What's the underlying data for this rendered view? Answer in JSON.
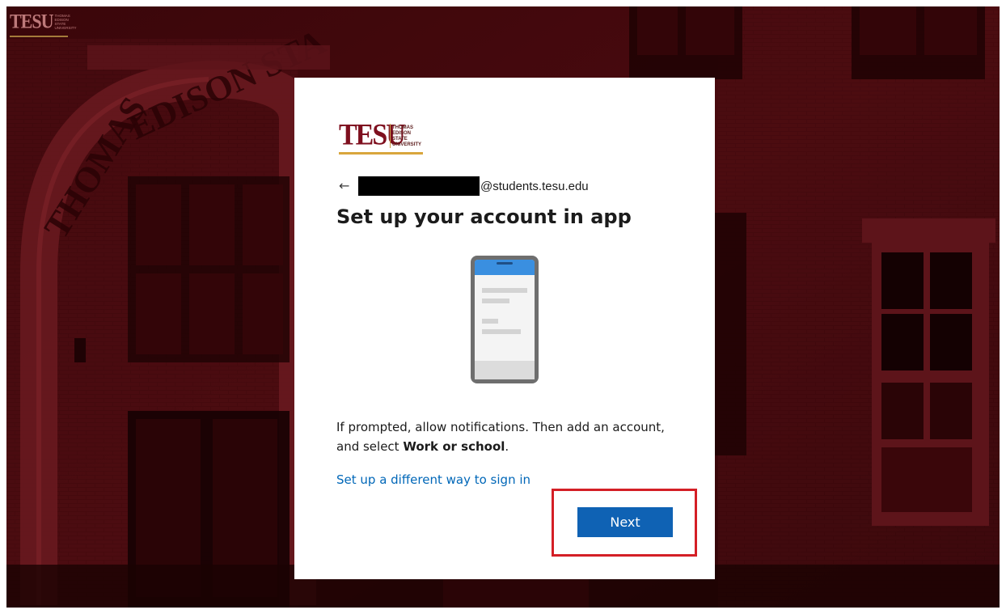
{
  "background": {
    "arch_text": "THOMAS EDISON STATE",
    "tint_color": "#5a0a10"
  },
  "corner_logo": {
    "mark": "TESU",
    "sub_lines": [
      "THOMAS",
      "EDISON",
      "STATE",
      "UNIVERSITY"
    ]
  },
  "card": {
    "brand": {
      "mark": "TESU",
      "sub_lines": [
        "THOMAS",
        "EDISON",
        "STATE",
        "UNIVERSITY"
      ],
      "mark_color": "#7e0f1e",
      "accent_color": "#d9a63c"
    },
    "identity": {
      "back_icon": "back-arrow-icon",
      "back_glyph": "←",
      "email_domain": "@students.tesu.edu"
    },
    "title": "Set up your account in app",
    "illustration": "phone-icon",
    "instructions": {
      "before": "If prompted, allow notifications. Then add an account, and select ",
      "bold": "Work or school",
      "after": "."
    },
    "alt_link": "Set up a different way to sign in",
    "next_button": "Next",
    "accent_color": "#0f62b4",
    "link_color": "#0067b8"
  },
  "annotation": {
    "highlight_color": "#d41f26"
  }
}
